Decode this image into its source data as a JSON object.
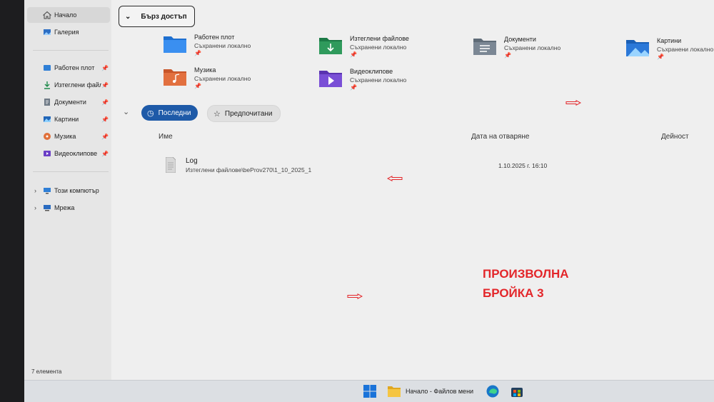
{
  "sidebar": {
    "top_items": [
      {
        "label": "Начало",
        "icon": "home-icon"
      },
      {
        "label": "Галерия",
        "icon": "gallery-icon"
      }
    ],
    "pinned_items": [
      {
        "label": "Работен плот",
        "icon": "desktop-icon"
      },
      {
        "label": "Изтеглени файлове",
        "icon": "download-icon"
      },
      {
        "label": "Документи",
        "icon": "documents-icon"
      },
      {
        "label": "Картини",
        "icon": "pictures-icon"
      },
      {
        "label": "Музика",
        "icon": "music-icon"
      },
      {
        "label": "Видеоклипове",
        "icon": "videos-icon"
      }
    ],
    "tree_items": [
      {
        "label": "Този компютър",
        "icon": "computer-icon"
      },
      {
        "label": "Мрежа",
        "icon": "network-icon"
      }
    ]
  },
  "status_bar": {
    "item_count": "7 елемента"
  },
  "quick_access": {
    "header": "Бърз достъп",
    "items": [
      {
        "name": "Работен плот",
        "status": "Съхранени локално",
        "icon": "desktop-folder-icon"
      },
      {
        "name": "Изтеглени файлове",
        "status": "Съхранени локално",
        "icon": "downloads-folder-icon"
      },
      {
        "name": "Документи",
        "status": "Съхранени локално",
        "icon": "documents-folder-icon"
      },
      {
        "name": "Картини",
        "status": "Съхранени локално",
        "icon": "pictures-folder-icon"
      },
      {
        "name": "Музика",
        "status": "Съхранени локално",
        "icon": "music-folder-icon"
      },
      {
        "name": "Видеоклипове",
        "status": "Съхранени локално",
        "icon": "videos-folder-icon"
      }
    ]
  },
  "tabs": {
    "recent": "Последни",
    "favorites": "Предпочитани"
  },
  "columns": {
    "name": "Име",
    "date": "Дата на отваряне",
    "action": "Дейност"
  },
  "recent_files": [
    {
      "name": "Log",
      "path": "Изтеглени файлове\\beProv270\\1_10_2025_1",
      "date": "1.10.2025 г. 16:10"
    }
  ],
  "annotation": {
    "text": "ПРОИЗВОЛНА\nБРОЙКА 3",
    "color": "#e3262a"
  },
  "taskbar": {
    "explorer_label": "Начало - Файлов мени"
  },
  "colors": {
    "accent": "#1e5aa8"
  }
}
